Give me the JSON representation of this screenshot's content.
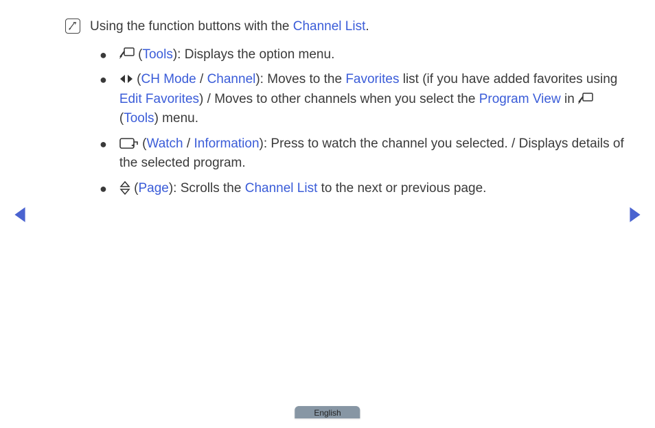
{
  "intro": {
    "pre": "Using the function buttons with the ",
    "link": "Channel List",
    "post": "."
  },
  "bullets": [
    {
      "icon": "tools-icon",
      "segments": [
        {
          "t": " ("
        },
        {
          "t": "Tools",
          "link": true
        },
        {
          "t": "): Displays the option menu."
        }
      ]
    },
    {
      "icon": "leftright-icon",
      "segments": [
        {
          "t": " ("
        },
        {
          "t": "CH Mode",
          "link": true
        },
        {
          "t": " / "
        },
        {
          "t": "Channel",
          "link": true
        },
        {
          "t": "): Moves to the "
        },
        {
          "t": "Favorites",
          "link": true
        },
        {
          "t": " list (if you have added favorites using "
        },
        {
          "t": "Edit Favorites",
          "link": true
        },
        {
          "t": ") / Moves to other channels when you select the "
        },
        {
          "t": "Program View",
          "link": true
        },
        {
          "t": " in "
        },
        {
          "icon": "tools-icon"
        },
        {
          "t": " ("
        },
        {
          "t": "Tools",
          "link": true
        },
        {
          "t": ") menu."
        }
      ]
    },
    {
      "icon": "enter-icon",
      "segments": [
        {
          "t": " ("
        },
        {
          "t": "Watch",
          "link": true
        },
        {
          "t": " / "
        },
        {
          "t": "Information",
          "link": true
        },
        {
          "t": "): Press to watch the channel you selected. / Displays details of the selected program."
        }
      ]
    },
    {
      "icon": "updown-icon",
      "segments": [
        {
          "t": " ("
        },
        {
          "t": "Page",
          "link": true
        },
        {
          "t": "): Scrolls the "
        },
        {
          "t": "Channel List",
          "link": true
        },
        {
          "t": " to the next or previous page."
        }
      ]
    }
  ],
  "footer": {
    "language": "English"
  }
}
